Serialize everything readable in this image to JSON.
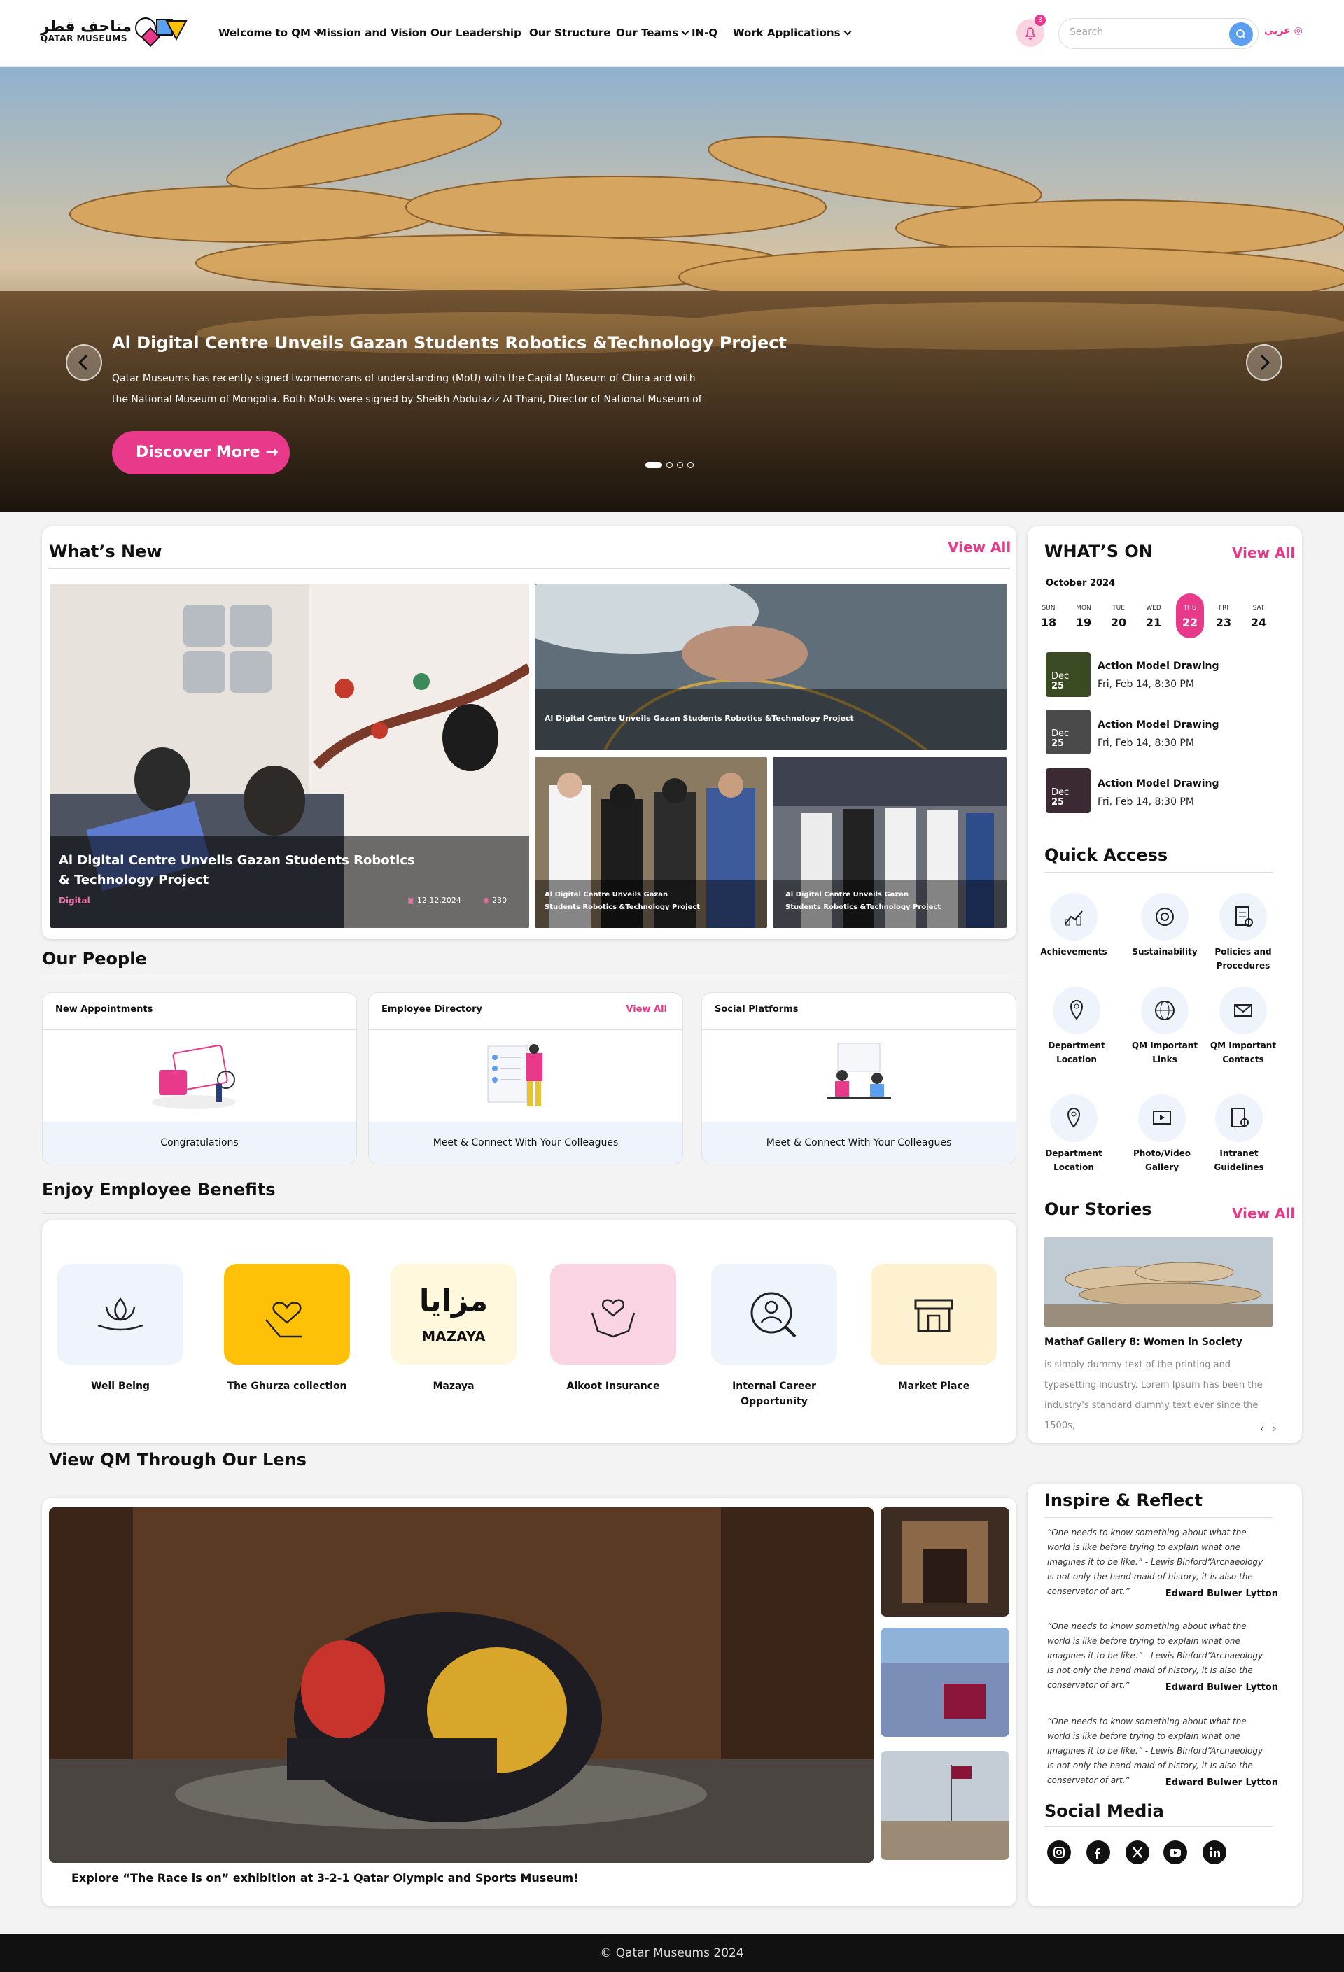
{
  "header": {
    "logo_ar": "متاحف قطر",
    "logo_en": "QATAR MUSEUMS",
    "nav": [
      {
        "label": "Welcome to QM",
        "has_menu": true
      },
      {
        "label": "Mission and Vision",
        "has_menu": false
      },
      {
        "label": "Our Leadership",
        "has_menu": false
      },
      {
        "label": "Our Structure",
        "has_menu": false
      },
      {
        "label": "Our Teams",
        "has_menu": true
      },
      {
        "label": "IN-Q",
        "has_menu": false
      },
      {
        "label": "Work Applications",
        "has_menu": true
      }
    ],
    "notifications_count": "3",
    "search_placeholder": "Search",
    "lang_label": "عربي"
  },
  "hero": {
    "title": "Al Digital Centre Unveils Gazan Students Robotics &Technology Project",
    "description": "Qatar Museums has recently signed twomemorans of understanding (MoU) with the Capital Museum of China and with the National Museum of Mongolia. Both MoUs were signed by Sheikh Abdulaziz Al Thani, Director of National Museum of",
    "button_label": "Discover More",
    "slides_total": 4,
    "active_slide": 1
  },
  "whats_new": {
    "title": "What’s New",
    "view_all": "View All",
    "main": {
      "title": "Al Digital Centre Unveils Gazan Students Robotics & Technology Project",
      "tag": "Digital",
      "date": "12.12.2024",
      "views": "230"
    },
    "side_top": "Al Digital Centre Unveils Gazan Students Robotics &Technology Project",
    "side_left": "Al Digital Centre Unveils Gazan Students Robotics &Technology Project",
    "side_right": "Al Digital Centre Unveils Gazan Students Robotics &Technology Project"
  },
  "whats_on": {
    "title": "WHAT’S ON",
    "view_all": "View All",
    "month": "October 2024",
    "days": [
      {
        "name": "SUN",
        "num": "18"
      },
      {
        "name": "MON",
        "num": "19"
      },
      {
        "name": "TUE",
        "num": "20"
      },
      {
        "name": "WED",
        "num": "21"
      },
      {
        "name": "THU",
        "num": "22",
        "selected": true
      },
      {
        "name": "FRI",
        "num": "23"
      },
      {
        "name": "SAT",
        "num": "24"
      }
    ],
    "events": [
      {
        "badge_month": "Dec",
        "badge_day": "25",
        "title": "Action Model Drawing",
        "time": "Fri, Feb 14, 8:30 PM"
      },
      {
        "badge_month": "Dec",
        "badge_day": "25",
        "title": "Action Model Drawing",
        "time": "Fri, Feb 14, 8:30 PM"
      },
      {
        "badge_month": "Dec",
        "badge_day": "25",
        "title": "Action Model Drawing",
        "time": "Fri, Feb 14, 8:30 PM"
      }
    ]
  },
  "quick_access": {
    "title": "Quick Access",
    "items": [
      {
        "label": "Achievements",
        "icon": "achievements-icon"
      },
      {
        "label": "Sustainability",
        "icon": "sustainability-icon"
      },
      {
        "label": "Policies and Procedures",
        "icon": "policies-icon"
      },
      {
        "label": "Department Location",
        "icon": "location-pin-icon"
      },
      {
        "label": "QM Important Links",
        "icon": "globe-icon"
      },
      {
        "label": "QM Important Contacts",
        "icon": "contacts-icon"
      },
      {
        "label": "Department Location",
        "icon": "location-pin-icon"
      },
      {
        "label": "Photo/Video Gallery",
        "icon": "gallery-icon"
      },
      {
        "label": "Intranet Guidelines",
        "icon": "guidelines-icon"
      }
    ]
  },
  "our_people": {
    "title": "Our People",
    "cards": [
      {
        "title": "New Appointments",
        "view_all": "",
        "footer": "Congratulations"
      },
      {
        "title": "Employee Directory",
        "view_all": "View All",
        "footer": "Meet & Connect With Your Colleagues"
      },
      {
        "title": "Social Platforms",
        "view_all": "",
        "footer": "Meet & Connect With Your Colleagues"
      }
    ]
  },
  "benefits": {
    "title": "Enjoy Employee Benefits",
    "mazaya_ar": "مزايا",
    "mazaya_en": "MAZAYA",
    "items": [
      {
        "label": "Well Being",
        "color": "#eef3fc",
        "icon": "lotus-hand-icon"
      },
      {
        "label": "The Ghurza collection",
        "color": "#ffc107",
        "icon": "heart-hand-icon"
      },
      {
        "label": "Mazaya",
        "color": "#fff8dc",
        "icon": "mazaya-logo"
      },
      {
        "label": "Alkoot Insurance",
        "color": "#fbd4e4",
        "icon": "care-hands-icon"
      },
      {
        "label": "Internal Career Opportunity",
        "color": "#eef3fc",
        "icon": "search-person-icon"
      },
      {
        "label": "Market Place",
        "color": "#fdf1cf",
        "icon": "store-icon"
      }
    ]
  },
  "our_stories": {
    "title": "Our Stories",
    "view_all": "View All",
    "story_title": "Mathaf Gallery 8: Women in Society",
    "story_text": "is simply dummy text of the printing and typesetting industry. Lorem Ipsum has been the industry's standard dummy text ever since the 1500s,"
  },
  "lens": {
    "title": "View QM Through Our Lens",
    "caption": "Explore “The Race is on” exhibition at 3-2-1 Qatar Olympic and Sports Museum!"
  },
  "inspire": {
    "title": "Inspire & Reflect",
    "quotes": [
      {
        "text": "“One needs to know something about what the world is like before trying to explain what one imagines it to be like.” - Lewis Binford“Archaeology is not only the hand maid of history, it is also the conservator of art.”",
        "author": "Edward Bulwer Lytton"
      },
      {
        "text": "“One needs to know something about what the world is like before trying to explain what one imagines it to be like.” - Lewis Binford“Archaeology is not only the hand maid of history, it is also the conservator of art.”",
        "author": "Edward Bulwer Lytton"
      },
      {
        "text": "“One needs to know something about what the world is like before trying to explain what one imagines it to be like.” - Lewis Binford“Archaeology is not only the hand maid of history, it is also the conservator of art.”",
        "author": "Edward Bulwer Lytton"
      }
    ]
  },
  "social_media": {
    "title": "Social Media",
    "icons": [
      "instagram-icon",
      "facebook-icon",
      "x-icon",
      "youtube-icon",
      "linkedin-icon"
    ]
  },
  "footer": {
    "copyright": "© Qatar Museums 2024"
  },
  "colors": {
    "accent": "#e8398a",
    "soft_blue": "#eef3fc"
  }
}
